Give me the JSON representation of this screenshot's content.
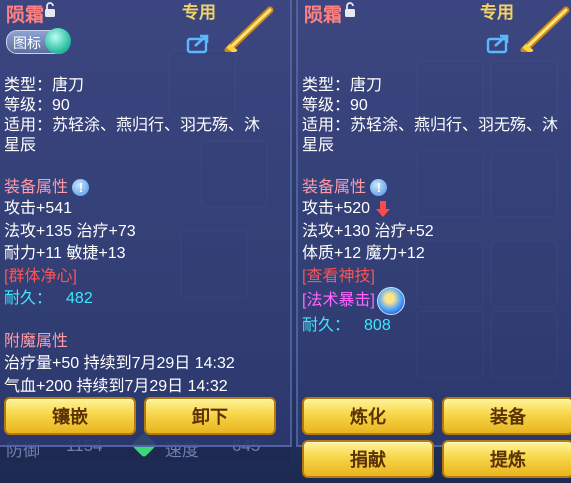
{
  "panel_left": {
    "title": "陨霜",
    "tag": "专用",
    "toggle_label": "图标",
    "lines": {
      "type": "类型：唐刀",
      "level": "等级：90",
      "suitable": "适用：苏轻涂、燕归行、羽无殇、沐",
      "suitable_cont": "星辰",
      "equip_attr": "装备属性",
      "attack": "攻击+541",
      "mag_heal": "法攻+135 治疗+73",
      "stam_agi": "耐力+11 敏捷+13",
      "special": "[群体净心]",
      "durability_label": "耐久：",
      "durability_value": "482",
      "enchant_attr": "附魔属性",
      "enchant1": "治疗量+50 持续到7月29日 14:32",
      "enchant2": "气血+200 持续到7月29日 14:32"
    },
    "buttons": {
      "inlay": "镶嵌",
      "unequip": "卸下"
    }
  },
  "panel_right": {
    "title": "陨霜",
    "tag": "专用",
    "lines": {
      "type": "类型：唐刀",
      "level": "等级：90",
      "suitable": "适用：苏轻涂、燕归行、羽无殇、沐",
      "suitable_cont": "星辰",
      "equip_attr": "装备属性",
      "attack": "攻击+520",
      "mag_heal": "法攻+130 治疗+52",
      "con_mag": "体质+12 魔力+12",
      "view_skill": "[查看神技]",
      "spell_crit": "[法术暴击]",
      "durability_label": "耐久：",
      "durability_value": "808"
    },
    "buttons": {
      "refine": "炼化",
      "equip": "装备",
      "donate": "捐献",
      "extract": "提炼"
    }
  },
  "background": {
    "stat_label": "防御",
    "stat_value": "1154",
    "speed_label": "速度",
    "speed_value": "645"
  },
  "colors": {
    "title": "#ff8080",
    "section": "#ff9aa8",
    "special_red": "#ff5252",
    "special_magenta": "#ff66ff",
    "durability": "#3ee6ff",
    "button": "#f7d64a"
  }
}
